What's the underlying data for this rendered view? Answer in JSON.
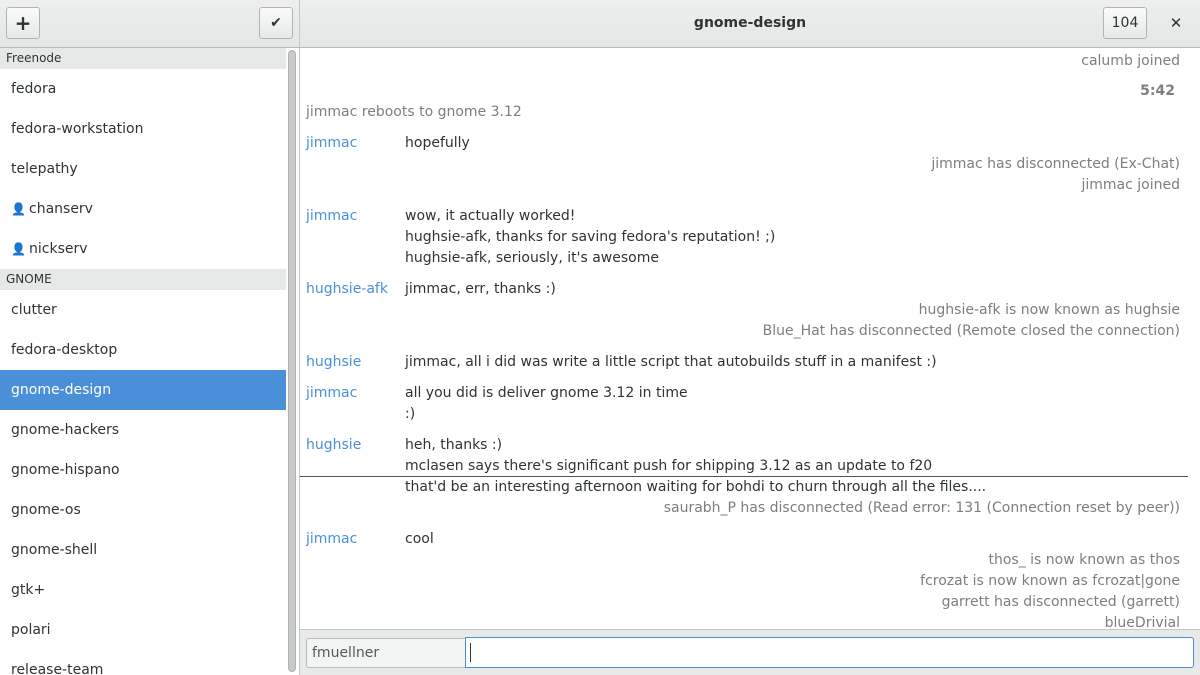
{
  "header": {
    "title": "gnome-design",
    "add_icon": "+",
    "confirm_icon": "✔",
    "user_count": "104",
    "close_icon": "✕"
  },
  "sidebar": {
    "networks": [
      {
        "name": "Freenode",
        "rooms": [
          {
            "label": "fedora",
            "private": false
          },
          {
            "label": "fedora-workstation",
            "private": false
          },
          {
            "label": "telepathy",
            "private": false
          },
          {
            "label": "chanserv",
            "private": true
          },
          {
            "label": "nickserv",
            "private": true
          }
        ]
      },
      {
        "name": "GNOME",
        "rooms": [
          {
            "label": "clutter",
            "private": false
          },
          {
            "label": "fedora-desktop",
            "private": false
          },
          {
            "label": "gnome-design",
            "private": false,
            "selected": true
          },
          {
            "label": "gnome-hackers",
            "private": false
          },
          {
            "label": "gnome-hispano",
            "private": false
          },
          {
            "label": "gnome-os",
            "private": false
          },
          {
            "label": "gnome-shell",
            "private": false
          },
          {
            "label": "gtk+",
            "private": false
          },
          {
            "label": "polari",
            "private": false
          },
          {
            "label": "release-team",
            "private": false
          }
        ]
      }
    ],
    "person_icon": "👤"
  },
  "chat": {
    "lines": [
      {
        "kind": "status",
        "text": "calumb joined"
      },
      {
        "kind": "timestamp",
        "text": "5:42"
      },
      {
        "kind": "note",
        "text": "jimmac reboots to gnome 3.12"
      },
      {
        "kind": "msg",
        "nick": "jimmac",
        "text": "hopefully"
      },
      {
        "kind": "status",
        "text": "jimmac has disconnected (Ex-Chat)"
      },
      {
        "kind": "status",
        "text": "jimmac joined"
      },
      {
        "kind": "msg",
        "nick": "jimmac",
        "text": "wow, it actually worked!"
      },
      {
        "kind": "msg",
        "nick": "",
        "text": "hughsie-afk, thanks for saving fedora's reputation! ;)"
      },
      {
        "kind": "msg",
        "nick": "",
        "text": "hughsie-afk, seriously, it's awesome"
      },
      {
        "kind": "msg",
        "nick": "hughsie-afk",
        "text": "jimmac, err, thanks :)"
      },
      {
        "kind": "status",
        "text": "hughsie-afk is now known as hughsie"
      },
      {
        "kind": "status",
        "text": "Blue_Hat has disconnected (Remote closed the connection)"
      },
      {
        "kind": "msg",
        "nick": "hughsie",
        "text": "jimmac, all i did was write a little script that autobuilds stuff in a manifest :)"
      },
      {
        "kind": "msg",
        "nick": "jimmac",
        "text": "all you did is deliver gnome 3.12 in time"
      },
      {
        "kind": "msg",
        "nick": "",
        "text": ":)"
      },
      {
        "kind": "msg",
        "nick": "hughsie",
        "text": "heh, thanks :)"
      },
      {
        "kind": "msg",
        "nick": "",
        "text": "mclasen says there's significant push for shipping 3.12 as an update to f20"
      },
      {
        "kind": "msg",
        "nick": "",
        "text": "that'd be an interesting afternoon waiting for bohdi to churn through all the files...."
      },
      {
        "kind": "status",
        "text": "saurabh_P has disconnected (Read error: 131 (Connection reset by peer))"
      },
      {
        "kind": "msg",
        "nick": "jimmac",
        "text": "cool"
      },
      {
        "kind": "status",
        "text": "thos_ is now known as thos"
      },
      {
        "kind": "status",
        "text": "fcrozat is now known as fcrozat|gone"
      },
      {
        "kind": "status",
        "text": "garrett has disconnected (garrett)"
      },
      {
        "kind": "status",
        "text": "blueDrivial"
      }
    ]
  },
  "input": {
    "nick": "fmuellner",
    "message_value": ""
  },
  "colors": {
    "accent": "#4a90d9",
    "status_text": "#7c7f7f"
  }
}
